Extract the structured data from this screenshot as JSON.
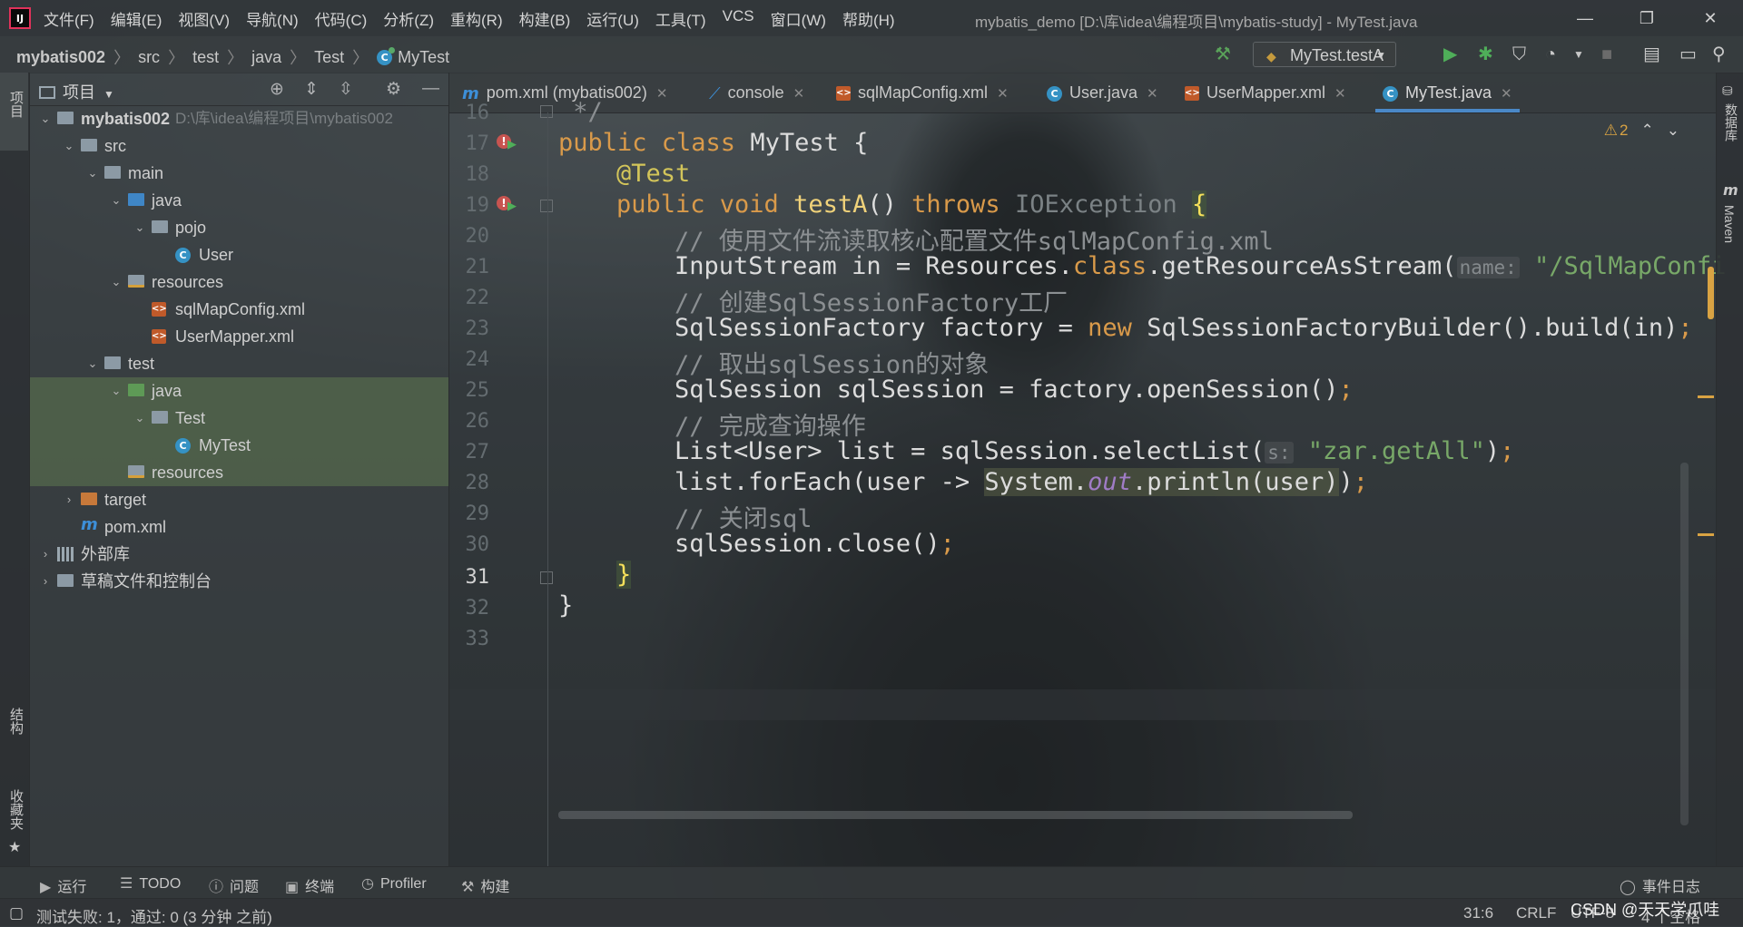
{
  "title_bar": {
    "app_logo": "IJ",
    "menu": [
      "文件(F)",
      "编辑(E)",
      "视图(V)",
      "导航(N)",
      "代码(C)",
      "分析(Z)",
      "重构(R)",
      "构建(B)",
      "运行(U)",
      "工具(T)",
      "VCS",
      "窗口(W)",
      "帮助(H)"
    ],
    "window_title": "mybatis_demo [D:\\库\\idea\\编程项目\\mybatis-study] - MyTest.java",
    "controls": {
      "minimize": "—",
      "restore": "❐",
      "close": "✕"
    }
  },
  "breadcrumb": [
    "mybatis002",
    "src",
    "test",
    "java",
    "Test",
    "MyTest"
  ],
  "run_config": {
    "label": "MyTest.testA"
  },
  "left_strip": {
    "project": "项目",
    "structure": "结构",
    "favorites": "收藏夹"
  },
  "project_panel": {
    "title": "项目",
    "tree": [
      {
        "label": "mybatis002",
        "hint": "D:\\库\\idea\\编程项目\\mybatis002",
        "depth": 0,
        "expanded": true,
        "icon": "module-folder-icon",
        "bold": true
      },
      {
        "label": "src",
        "depth": 1,
        "expanded": true,
        "icon": "folder-icon"
      },
      {
        "label": "main",
        "depth": 2,
        "expanded": true,
        "icon": "folder-icon"
      },
      {
        "label": "java",
        "depth": 3,
        "expanded": true,
        "icon": "source-folder-icon"
      },
      {
        "label": "pojo",
        "depth": 4,
        "expanded": true,
        "icon": "package-icon"
      },
      {
        "label": "User",
        "depth": 5,
        "icon": "class-icon"
      },
      {
        "label": "resources",
        "depth": 3,
        "expanded": true,
        "icon": "resources-folder-icon"
      },
      {
        "label": "sqlMapConfig.xml",
        "depth": 4,
        "icon": "xml-file-icon"
      },
      {
        "label": "UserMapper.xml",
        "depth": 4,
        "icon": "xml-file-icon"
      },
      {
        "label": "test",
        "depth": 2,
        "expanded": true,
        "icon": "folder-icon"
      },
      {
        "label": "java",
        "depth": 3,
        "expanded": true,
        "icon": "test-folder-icon"
      },
      {
        "label": "Test",
        "depth": 4,
        "expanded": true,
        "icon": "package-icon"
      },
      {
        "label": "MyTest",
        "depth": 5,
        "icon": "class-icon",
        "selected": true
      },
      {
        "label": "resources",
        "depth": 3,
        "icon": "test-resources-folder-icon"
      },
      {
        "label": "target",
        "depth": 1,
        "collapsed": true,
        "icon": "excluded-folder-icon"
      },
      {
        "label": "pom.xml",
        "depth": 1,
        "icon": "maven-icon"
      },
      {
        "label": "外部库",
        "depth": 0,
        "collapsed": true,
        "icon": "library-icon"
      },
      {
        "label": "草稿文件和控制台",
        "depth": 0,
        "collapsed": true,
        "icon": "scratches-icon"
      }
    ]
  },
  "tabs": [
    {
      "label": "pom.xml (mybatis002)",
      "icon": "maven-icon"
    },
    {
      "label": "console",
      "icon": "console-icon"
    },
    {
      "label": "sqlMapConfig.xml",
      "icon": "xml-file-icon"
    },
    {
      "label": "User.java",
      "icon": "class-icon"
    },
    {
      "label": "UserMapper.xml",
      "icon": "xml-file-icon"
    },
    {
      "label": "MyTest.java",
      "icon": "class-icon",
      "active": true
    }
  ],
  "editor": {
    "warnings": "2",
    "current_line": 31,
    "line_numbers": [
      "16",
      "17",
      "18",
      "19",
      "20",
      "21",
      "22",
      "23",
      "24",
      "25",
      "26",
      "27",
      "28",
      "29",
      "30",
      "31",
      "32",
      "33"
    ],
    "code": {
      "l16": " */",
      "l17_kw": "public class ",
      "l17_name": "MyTest {",
      "l18": "@Test",
      "l19_kw1": "public void ",
      "l19_fn": "testA",
      "l19_mid": "() ",
      "l19_kw2": "throws ",
      "l19_ex": "IOException ",
      "l19_brace": "{",
      "l20": "// 使用文件流读取核心配置文件sqlMapConfig.xml",
      "l21_a": "InputStream in = Resources.",
      "l21_kw": "class",
      "l21_b": ".getResourceAsStream(",
      "l21_hint": "name:",
      "l21_str": " \"/SqlMapConfi",
      "l22": "// 创建SqlSessionFactory工厂",
      "l23_a": "SqlSessionFactory factory = ",
      "l23_kw": "new",
      "l23_b": " SqlSessionFactoryBuilder().build(in)",
      "l23_semi": ";",
      "l24": "// 取出sqlSession的对象",
      "l25_a": "SqlSession sqlSession = factory.openSession()",
      "l25_semi": ";",
      "l26": "// 完成查询操作",
      "l27_a": "List<User> list = sqlSession.selectList(",
      "l27_hint": "s:",
      "l27_str": " \"zar.getAll\"",
      "l27_b": ")",
      "l27_semi": ";",
      "l28_a": "list.forEach(user -> ",
      "l28_hl1": "System.",
      "l28_fld": "out",
      "l28_hl2": ".println(user)",
      "l28_b": ")",
      "l28_semi": ";",
      "l29": "// 关闭sql",
      "l30_a": "sqlSession.close()",
      "l30_semi": ";",
      "l31": "}",
      "l32": "}"
    }
  },
  "right_strip": {
    "database": "数据库",
    "maven": "Maven"
  },
  "bottom_toolbar": {
    "run": "运行",
    "todo": "TODO",
    "problems": "问题",
    "terminal": "终端",
    "profiler": "Profiler",
    "build": "构建",
    "event_log": "事件日志"
  },
  "status_bar": {
    "message": "测试失败: 1，通过: 0 (3 分钟 之前)",
    "position": "31:6",
    "line_sep": "CRLF",
    "encoding": "UTF-8",
    "indent": "4 个空格",
    "watermark": "CSDN @天天学爪哇"
  },
  "colors": {
    "accent": "#4a88c7",
    "selection": "#4570b0",
    "keyword": "#d99a4a",
    "annotation": "#d3c55a",
    "string": "#78a868"
  }
}
